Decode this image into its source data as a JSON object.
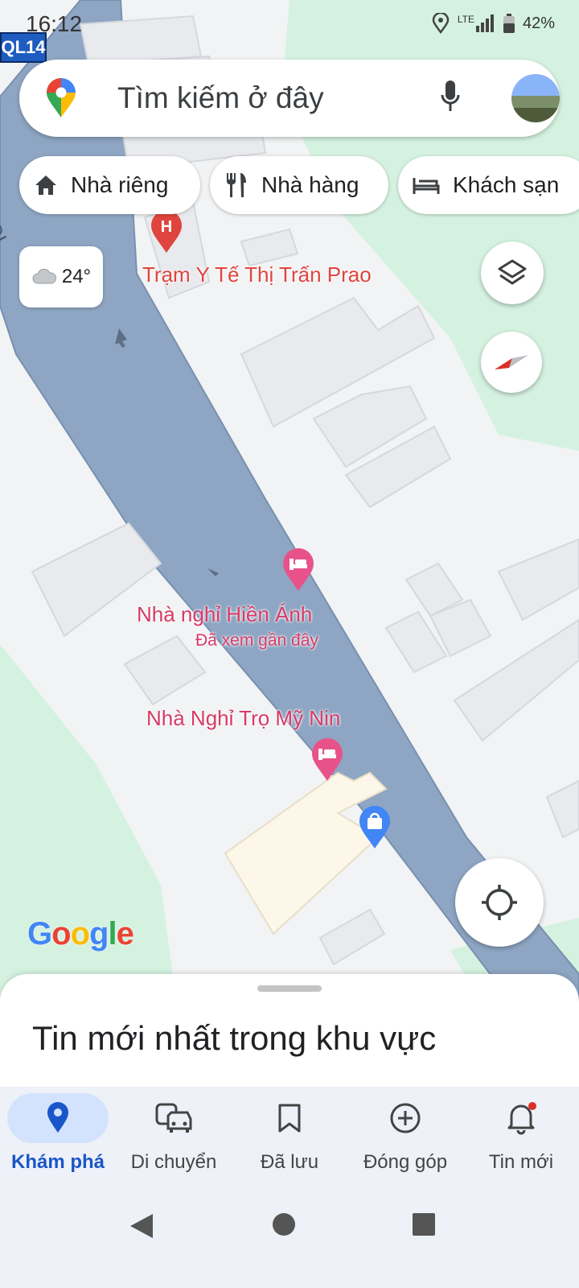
{
  "status_bar": {
    "time": "16:12",
    "network": "LTE",
    "battery": "42%"
  },
  "route_shield": "QL14",
  "search": {
    "placeholder": "Tìm kiếm ở đây"
  },
  "chips": [
    {
      "label": "Nhà riêng",
      "icon": "home-icon"
    },
    {
      "label": "Nhà hàng",
      "icon": "restaurant-icon"
    },
    {
      "label": "Khách sạn",
      "icon": "hotel-icon"
    }
  ],
  "weather": {
    "temp": "24°",
    "icon": "cloud-icon"
  },
  "map_labels": {
    "hospital": "Trạm Y Tế Thị Trấn Prao",
    "hotel_1": "Nhà nghỉ Hiền Ánh",
    "hotel_1_sub": "Đã xem gần đây",
    "hotel_2": "Nhà Nghỉ Trọ Mỹ Nin",
    "road_left": "QL"
  },
  "google_logo": "Google",
  "sheet": {
    "title": "Tin mới nhất trong khu vực"
  },
  "nav": [
    {
      "label": "Khám phá",
      "icon": "explore-pin-icon",
      "active": true
    },
    {
      "label": "Di chuyển",
      "icon": "commute-icon",
      "active": false
    },
    {
      "label": "Đã lưu",
      "icon": "bookmark-icon",
      "active": false
    },
    {
      "label": "Đóng góp",
      "icon": "add-circle-icon",
      "active": false
    },
    {
      "label": "Tin mới",
      "icon": "bell-icon",
      "active": false
    }
  ],
  "colors": {
    "road": "#8ea6c3",
    "greenery": "#d5f2e0",
    "land": "#f1f3f4",
    "building": "#e8eaed",
    "accent": "#1a56c9",
    "poi_pink": "#e8528a"
  }
}
